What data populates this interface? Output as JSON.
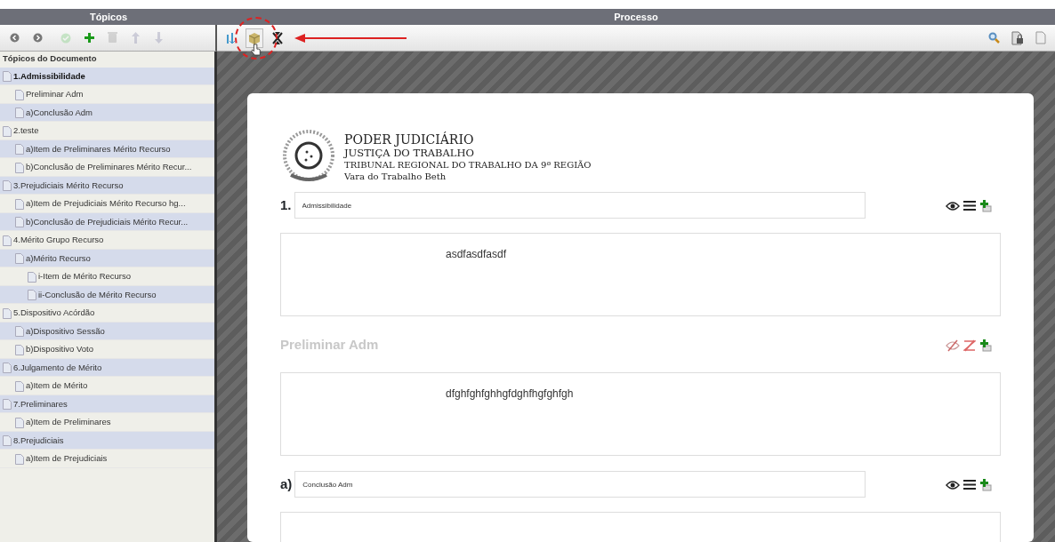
{
  "panels": {
    "left_title": "Tópicos",
    "right_title": "Processo"
  },
  "topic_toolbar": [
    {
      "kind": "back",
      "disabled": false
    },
    {
      "kind": "forward",
      "disabled": false
    },
    {
      "kind": "check",
      "disabled": true
    },
    {
      "kind": "add",
      "disabled": false
    },
    {
      "kind": "delete",
      "disabled": true
    },
    {
      "kind": "up",
      "disabled": true
    },
    {
      "kind": "down",
      "disabled": true
    }
  ],
  "process_toolbar": [
    {
      "kind": "sort",
      "selected": false
    },
    {
      "kind": "package",
      "selected": true
    },
    {
      "kind": "collapse",
      "selected": false
    }
  ],
  "process_toolbar_right": [
    {
      "kind": "search"
    },
    {
      "kind": "lock"
    },
    {
      "kind": "page"
    }
  ],
  "tree": {
    "heading": "Tópicos do Documento",
    "items": [
      {
        "label": "1.Admissibilidade",
        "bold": true,
        "children": [
          {
            "label": "Preliminar Adm"
          },
          {
            "label": "a)Conclusão Adm"
          }
        ]
      },
      {
        "label": "2.teste",
        "children": [
          {
            "label": "a)Item de Preliminares Mérito Recurso"
          },
          {
            "label": "b)Conclusão de Preliminares Mérito Recur..."
          }
        ]
      },
      {
        "label": "3.Prejudiciais Mérito Recurso",
        "children": [
          {
            "label": "a)Item de Prejudiciais Mérito Recurso hg..."
          },
          {
            "label": "b)Conclusão de Prejudiciais Mérito Recur..."
          }
        ]
      },
      {
        "label": "4.Mérito Grupo Recurso",
        "children": [
          {
            "label": "a)Mérito Recurso",
            "children": [
              {
                "label": "i-Item de Mérito Recurso"
              },
              {
                "label": "ii-Conclusão de Mérito Recurso"
              }
            ]
          }
        ]
      },
      {
        "label": "5.Dispositivo Acórdão",
        "children": [
          {
            "label": "a)Dispositivo Sessão"
          },
          {
            "label": "b)Dispositivo Voto"
          }
        ]
      },
      {
        "label": "6.Julgamento de Mérito",
        "children": [
          {
            "label": "a)Item de Mérito"
          }
        ]
      },
      {
        "label": "7.Preliminares",
        "children": [
          {
            "label": "a)Item de Preliminares"
          }
        ]
      },
      {
        "label": "8.Prejudiciais",
        "children": [
          {
            "label": "a)Item de Prejudiciais"
          }
        ]
      }
    ]
  },
  "document": {
    "header": [
      "PODER JUDICIÁRIO",
      "JUSTIÇA DO TRABALHO",
      "TRIBUNAL REGIONAL DO TRABALHO DA 9ª REGIÃO",
      "Vara do Trabalho Beth"
    ],
    "sections": [
      {
        "kind": "numbered",
        "number": "1.",
        "title": "Admissibilidade",
        "visible": true,
        "body": "asdfasdfasdf"
      },
      {
        "kind": "plain",
        "title": "Preliminar Adm",
        "visible": false,
        "body": "dfghfghfghhgfdghfhgfghfgh"
      },
      {
        "kind": "numbered",
        "number": "a)",
        "title": "Conclusão Adm",
        "visible": true
      }
    ]
  }
}
